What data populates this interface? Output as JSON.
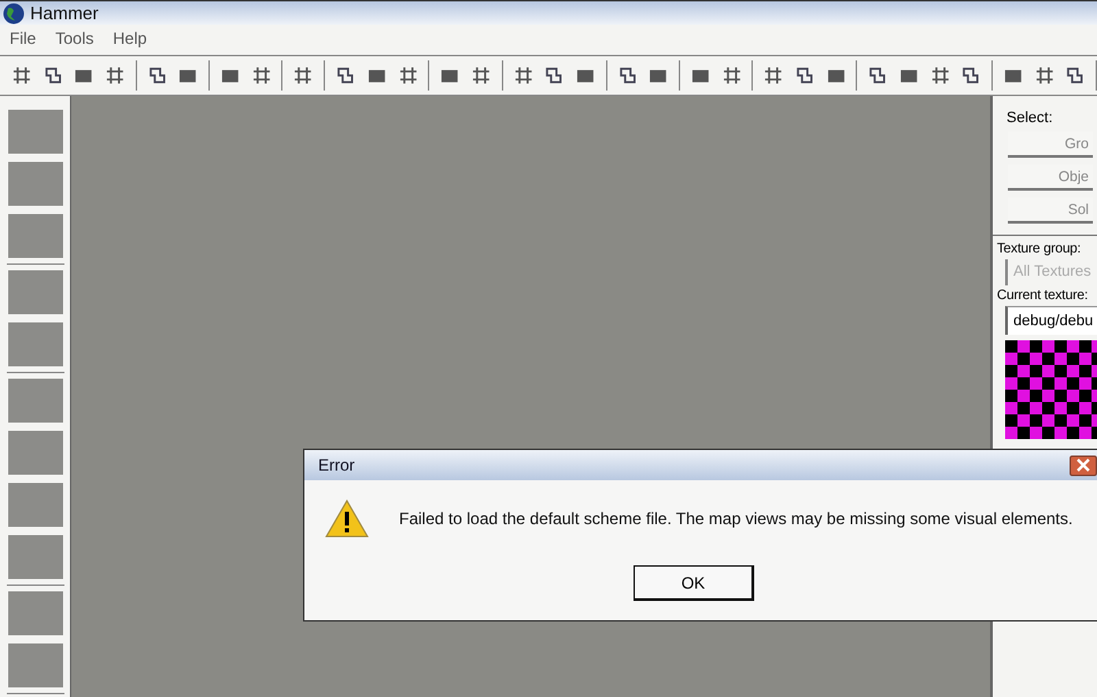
{
  "window": {
    "title": "Hammer"
  },
  "menu": [
    {
      "label": "File"
    },
    {
      "label": "Tools"
    },
    {
      "label": "Help"
    }
  ],
  "right_panel": {
    "select_label": "Select:",
    "select_buttons": [
      "Gro",
      "Obje",
      "Sol"
    ],
    "texture_group_label": "Texture group:",
    "texture_group": {
      "value": "All Textures",
      "disabled": true
    },
    "current_texture_label": "Current texture:",
    "current_texture": {
      "value": "debug/debu"
    }
  },
  "dialog": {
    "title": "Error",
    "message": "Failed to load the default scheme file. The map views may be missing some visual elements.",
    "buttons": [
      "OK"
    ]
  }
}
